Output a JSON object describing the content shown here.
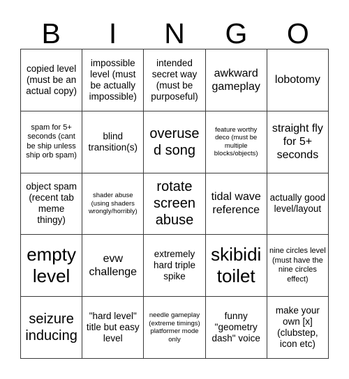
{
  "card": {
    "title": "BINGO",
    "header_letters": [
      "B",
      "I",
      "N",
      "G",
      "O"
    ],
    "rows": 5,
    "columns": 5,
    "border_color": "#3a3a3a",
    "background_color": "#ffffff",
    "text_color": "#000000",
    "cells": [
      {
        "text": "copied level (must be an actual copy)",
        "size": "md"
      },
      {
        "text": "impossible level (must be actually impossible)",
        "size": "md"
      },
      {
        "text": "intended secret way (must be purposeful)",
        "size": "md"
      },
      {
        "text": "awkward gameplay",
        "size": "lg"
      },
      {
        "text": "lobotomy",
        "size": "lg"
      },
      {
        "text": "spam for 5+ seconds (cant be ship unless ship orb spam)",
        "size": "sm"
      },
      {
        "text": "blind transition(s)",
        "size": "md"
      },
      {
        "text": "overused song",
        "size": "xl"
      },
      {
        "text": "feature worthy deco (must be multiple blocks/objects)",
        "size": "xs"
      },
      {
        "text": "straight fly for 5+ seconds",
        "size": "lg"
      },
      {
        "text": "object spam (recent tab meme thingy)",
        "size": "md"
      },
      {
        "text": "shader abuse (using shaders wrongly/horribly)",
        "size": "xs"
      },
      {
        "text": "rotate screen abuse",
        "size": "xl"
      },
      {
        "text": "tidal wave reference",
        "size": "lg"
      },
      {
        "text": "actually good level/layout",
        "size": "md"
      },
      {
        "text": "empty level",
        "size": "xxl"
      },
      {
        "text": "evw challenge",
        "size": "lg"
      },
      {
        "text": "extremely hard triple spike",
        "size": "md"
      },
      {
        "text": "skibidi toilet",
        "size": "xxl"
      },
      {
        "text": "nine circles level (must have the nine circles effect)",
        "size": "sm"
      },
      {
        "text": "seizure inducing",
        "size": "xl"
      },
      {
        "text": "\"hard level\" title but easy level",
        "size": "md"
      },
      {
        "text": "needle gameplay (extreme timings) platformer mode only",
        "size": "xs"
      },
      {
        "text": "funny \"geometry dash\" voice",
        "size": "md"
      },
      {
        "text": "make your own [x] (clubstep, icon etc)",
        "size": "md"
      }
    ]
  }
}
